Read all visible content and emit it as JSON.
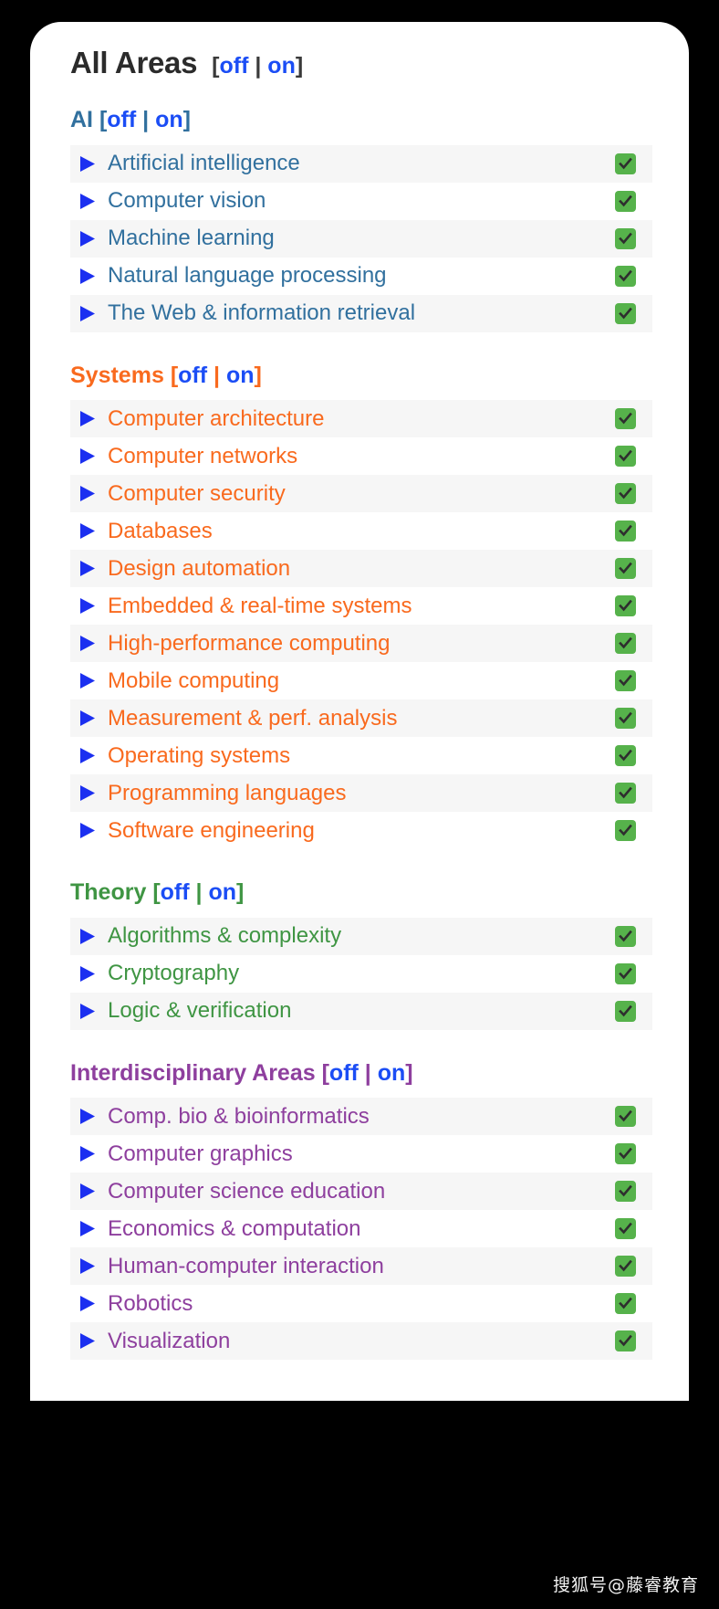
{
  "all_areas": {
    "title": "All Areas",
    "toggle_open": "[",
    "off_label": "off",
    "separator": " | ",
    "on_label": "on",
    "toggle_close": "]"
  },
  "colors": {
    "ai": "#31709e",
    "systems": "#f96a1e",
    "theory": "#3f9543",
    "interdisciplinary": "#8e3f9e",
    "toggle_link": "#1b4df5",
    "triangle": "#1b2ff0",
    "checkbox": "#56b24b",
    "row_alt_bg": "#f6f6f6",
    "title": "#2b2b2b"
  },
  "icons": {
    "triangle": "triangle-right-icon",
    "check": "check-icon"
  },
  "sections": [
    {
      "id": "ai",
      "name": "AI",
      "color": "#31709e",
      "toggle_open": "[",
      "off_label": "off",
      "separator": " | ",
      "on_label": "on",
      "toggle_close": "]",
      "rows": [
        {
          "label": "Artificial intelligence",
          "checked": true
        },
        {
          "label": "Computer vision",
          "checked": true
        },
        {
          "label": "Machine learning",
          "checked": true
        },
        {
          "label": "Natural language processing",
          "checked": true
        },
        {
          "label": "The Web & information retrieval",
          "checked": true
        }
      ]
    },
    {
      "id": "systems",
      "name": "Systems",
      "color": "#f96a1e",
      "toggle_open": "[",
      "off_label": "off",
      "separator": " | ",
      "on_label": "on",
      "toggle_close": "]",
      "rows": [
        {
          "label": "Computer architecture",
          "checked": true
        },
        {
          "label": "Computer networks",
          "checked": true
        },
        {
          "label": "Computer security",
          "checked": true
        },
        {
          "label": "Databases",
          "checked": true
        },
        {
          "label": "Design automation",
          "checked": true
        },
        {
          "label": "Embedded & real-time systems",
          "checked": true
        },
        {
          "label": "High-performance computing",
          "checked": true
        },
        {
          "label": "Mobile computing",
          "checked": true
        },
        {
          "label": "Measurement & perf. analysis",
          "checked": true
        },
        {
          "label": "Operating systems",
          "checked": true
        },
        {
          "label": "Programming languages",
          "checked": true
        },
        {
          "label": "Software engineering",
          "checked": true
        }
      ]
    },
    {
      "id": "theory",
      "name": "Theory",
      "color": "#3f9543",
      "toggle_open": "[",
      "off_label": "off",
      "separator": " | ",
      "on_label": "on",
      "toggle_close": "]",
      "rows": [
        {
          "label": "Algorithms & complexity",
          "checked": true
        },
        {
          "label": "Cryptography",
          "checked": true
        },
        {
          "label": "Logic & verification",
          "checked": true
        }
      ]
    },
    {
      "id": "interdisciplinary",
      "name": "Interdisciplinary Areas",
      "color": "#8e3f9e",
      "toggle_open": "[",
      "off_label": "off",
      "separator": " | ",
      "on_label": "on",
      "toggle_close": "]",
      "rows": [
        {
          "label": "Comp. bio & bioinformatics",
          "checked": true
        },
        {
          "label": "Computer graphics",
          "checked": true
        },
        {
          "label": "Computer science education",
          "checked": true
        },
        {
          "label": "Economics & computation",
          "checked": true
        },
        {
          "label": "Human-computer interaction",
          "checked": true
        },
        {
          "label": "Robotics",
          "checked": true
        },
        {
          "label": "Visualization",
          "checked": true
        }
      ]
    }
  ],
  "watermark": {
    "text": "搜狐号@藤睿教育"
  }
}
